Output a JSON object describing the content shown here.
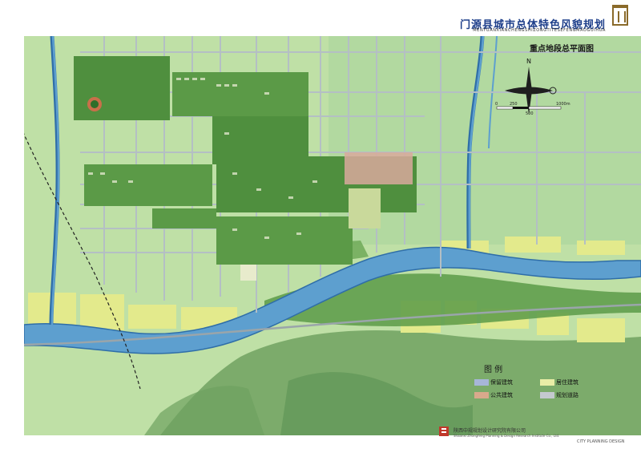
{
  "header": {
    "title": "门源县城市总体特色风貌规划",
    "subtitle": "MENYUANXIANCHENGSHIZONGTITESEFENGMAOGUIHUA"
  },
  "map": {
    "subtitle": "重点地段总平面图",
    "north_label": "N",
    "scale_labels": [
      "0",
      "250",
      "500",
      "1000m"
    ],
    "colors": {
      "background": "#bfe0a6",
      "river": "#5d9fcf",
      "river_edge": "#2f6ea8",
      "fields_yellow": "#dfe98b",
      "mountain": "#78a86c",
      "road": "#b4bfc4",
      "urban_green": "#4f8f3e"
    }
  },
  "legend": {
    "title": "图 例",
    "items": [
      {
        "label": "保留建筑",
        "color": "#a7b6d8"
      },
      {
        "label": "居住建筑",
        "color": "#e9eda6"
      },
      {
        "label": "公共建筑",
        "color": "#d9a98c"
      },
      {
        "label": "规划道路",
        "color": "#c4c9cf"
      }
    ]
  },
  "footer": {
    "org_cn": "陕西中规规划设计研究院有限公司",
    "org_en": "Shaanxi Zhongfeng Planning & Design Research Institute Co., Ltd.",
    "org_en2": "CITY PLANNING DESIGN"
  }
}
